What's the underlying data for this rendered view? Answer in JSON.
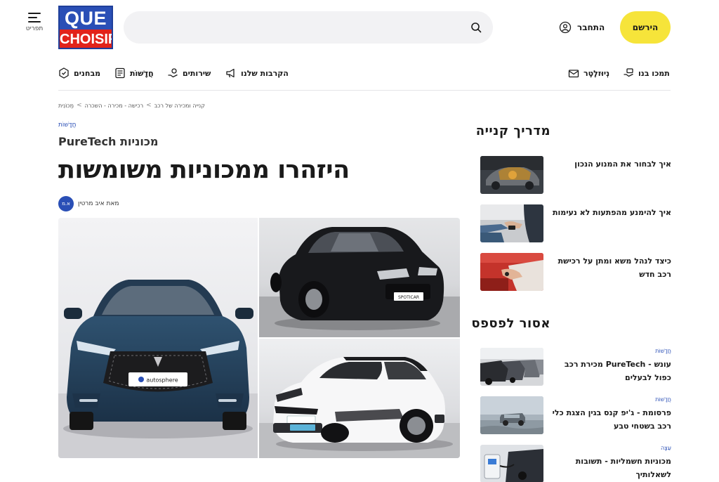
{
  "header": {
    "menu_label": "תפריט",
    "logo_top": "QUE",
    "logo_bottom": "CHOISIR",
    "search_placeholder": "",
    "login_label": "התחבר",
    "signup_label": "הירשם"
  },
  "nav": {
    "left": [
      {
        "label": "מבחנים",
        "icon": "badge-icon"
      },
      {
        "label": "חֲדָשׁוֹת",
        "icon": "news-icon"
      },
      {
        "label": "שירותים",
        "icon": "services-icon"
      },
      {
        "label": "הקרבות שלנו",
        "icon": "megaphone-icon"
      }
    ],
    "right": [
      {
        "label": "נְיוּזלֶטֶר",
        "icon": "mail-icon"
      },
      {
        "label": "תמכו בנו",
        "icon": "support-icon"
      }
    ]
  },
  "breadcrumb": [
    "מְכוֹנִית",
    "רכישה - מכירה - השכרה",
    "קנייה ומכירה של רכב"
  ],
  "article": {
    "tag": "חֲדָשׁוֹת",
    "subtitle": "מכוניות PureTech",
    "title": "היזהרו ממכוניות משומשות",
    "author_initials": "א.מ",
    "author": "מאת איב מרטין",
    "plates": [
      "autosphere",
      "SPOTICAR",
      ""
    ]
  },
  "sidebar": {
    "buying_guide_title": "מדריך קנייה",
    "buying_guide": [
      {
        "title": "איך לבחור את המנוע הנכון"
      },
      {
        "title": "איך להימנע מהפתעות לא נעימות"
      },
      {
        "title": "כיצד לנהל משא ומתן על רכישת רכב חדש"
      }
    ],
    "dont_miss_title": "אסור לפספס",
    "dont_miss": [
      {
        "tag": "חֲדָשׁוֹת",
        "title": "עונש - PureTech מכירת רכב כפול לבעלים"
      },
      {
        "tag": "חֲדָשׁוֹת",
        "title": "פרסומת - ג'יפ קנס בגין הצגת כלי רכב בשטחי טבע"
      },
      {
        "tag": "עֵצָה",
        "title": "מכוניות חשמליות - תשובות לשאלותיך"
      }
    ]
  },
  "colors": {
    "brand_blue": "#2a4fb6",
    "brand_red": "#e2231a",
    "accent_yellow": "#f6e43a"
  }
}
